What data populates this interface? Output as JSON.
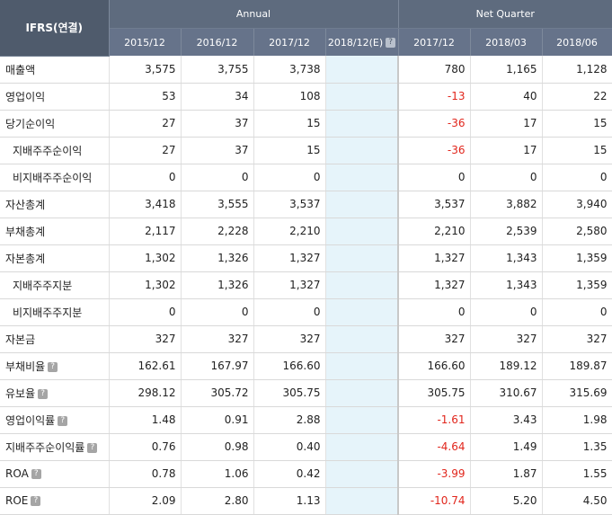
{
  "header": {
    "corner": "IFRS(연결)",
    "annual": "Annual",
    "net_quarter": "Net Quarter",
    "periods": [
      "2015/12",
      "2016/12",
      "2017/12",
      "2018/12(E)",
      "2017/12",
      "2018/03",
      "2018/06"
    ]
  },
  "rows": [
    {
      "label": "매출액",
      "sub": false,
      "help": false,
      "values": [
        "3,575",
        "3,755",
        "3,738",
        "",
        "780",
        "1,165",
        "1,128"
      ]
    },
    {
      "label": "영업이익",
      "sub": false,
      "help": false,
      "values": [
        "53",
        "34",
        "108",
        "",
        "-13",
        "40",
        "22"
      ]
    },
    {
      "label": "당기순이익",
      "sub": false,
      "help": false,
      "values": [
        "27",
        "37",
        "15",
        "",
        "-36",
        "17",
        "15"
      ]
    },
    {
      "label": "지배주주순이익",
      "sub": true,
      "help": false,
      "values": [
        "27",
        "37",
        "15",
        "",
        "-36",
        "17",
        "15"
      ]
    },
    {
      "label": "비지배주주순이익",
      "sub": true,
      "help": false,
      "values": [
        "0",
        "0",
        "0",
        "",
        "0",
        "0",
        "0"
      ]
    },
    {
      "label": "자산총계",
      "sub": false,
      "help": false,
      "values": [
        "3,418",
        "3,555",
        "3,537",
        "",
        "3,537",
        "3,882",
        "3,940"
      ]
    },
    {
      "label": "부채총계",
      "sub": false,
      "help": false,
      "values": [
        "2,117",
        "2,228",
        "2,210",
        "",
        "2,210",
        "2,539",
        "2,580"
      ]
    },
    {
      "label": "자본총계",
      "sub": false,
      "help": false,
      "values": [
        "1,302",
        "1,326",
        "1,327",
        "",
        "1,327",
        "1,343",
        "1,359"
      ]
    },
    {
      "label": "지배주주지분",
      "sub": true,
      "help": false,
      "values": [
        "1,302",
        "1,326",
        "1,327",
        "",
        "1,327",
        "1,343",
        "1,359"
      ]
    },
    {
      "label": "비지배주주지분",
      "sub": true,
      "help": false,
      "values": [
        "0",
        "0",
        "0",
        "",
        "0",
        "0",
        "0"
      ]
    },
    {
      "label": "자본금",
      "sub": false,
      "help": false,
      "values": [
        "327",
        "327",
        "327",
        "",
        "327",
        "327",
        "327"
      ]
    },
    {
      "label": "부채비율",
      "sub": false,
      "help": true,
      "values": [
        "162.61",
        "167.97",
        "166.60",
        "",
        "166.60",
        "189.12",
        "189.87"
      ]
    },
    {
      "label": "유보율",
      "sub": false,
      "help": true,
      "values": [
        "298.12",
        "305.72",
        "305.75",
        "",
        "305.75",
        "310.67",
        "315.69"
      ]
    },
    {
      "label": "영업이익률",
      "sub": false,
      "help": true,
      "values": [
        "1.48",
        "0.91",
        "2.88",
        "",
        "-1.61",
        "3.43",
        "1.98"
      ]
    },
    {
      "label": "지배주주순이익률",
      "sub": false,
      "help": true,
      "values": [
        "0.76",
        "0.98",
        "0.40",
        "",
        "-4.64",
        "1.49",
        "1.35"
      ]
    },
    {
      "label": "ROA",
      "sub": false,
      "help": true,
      "values": [
        "0.78",
        "1.06",
        "0.42",
        "",
        "-3.99",
        "1.87",
        "1.55"
      ]
    },
    {
      "label": "ROE",
      "sub": false,
      "help": true,
      "values": [
        "2.09",
        "2.80",
        "1.13",
        "",
        "-10.74",
        "5.20",
        "4.50"
      ]
    }
  ],
  "colors": {
    "header_bg": "#5e6b7e",
    "negative": "#e1261c",
    "estimate_col_bg": "#e6f4fa"
  },
  "icons": {
    "help": "question-mark-icon"
  }
}
